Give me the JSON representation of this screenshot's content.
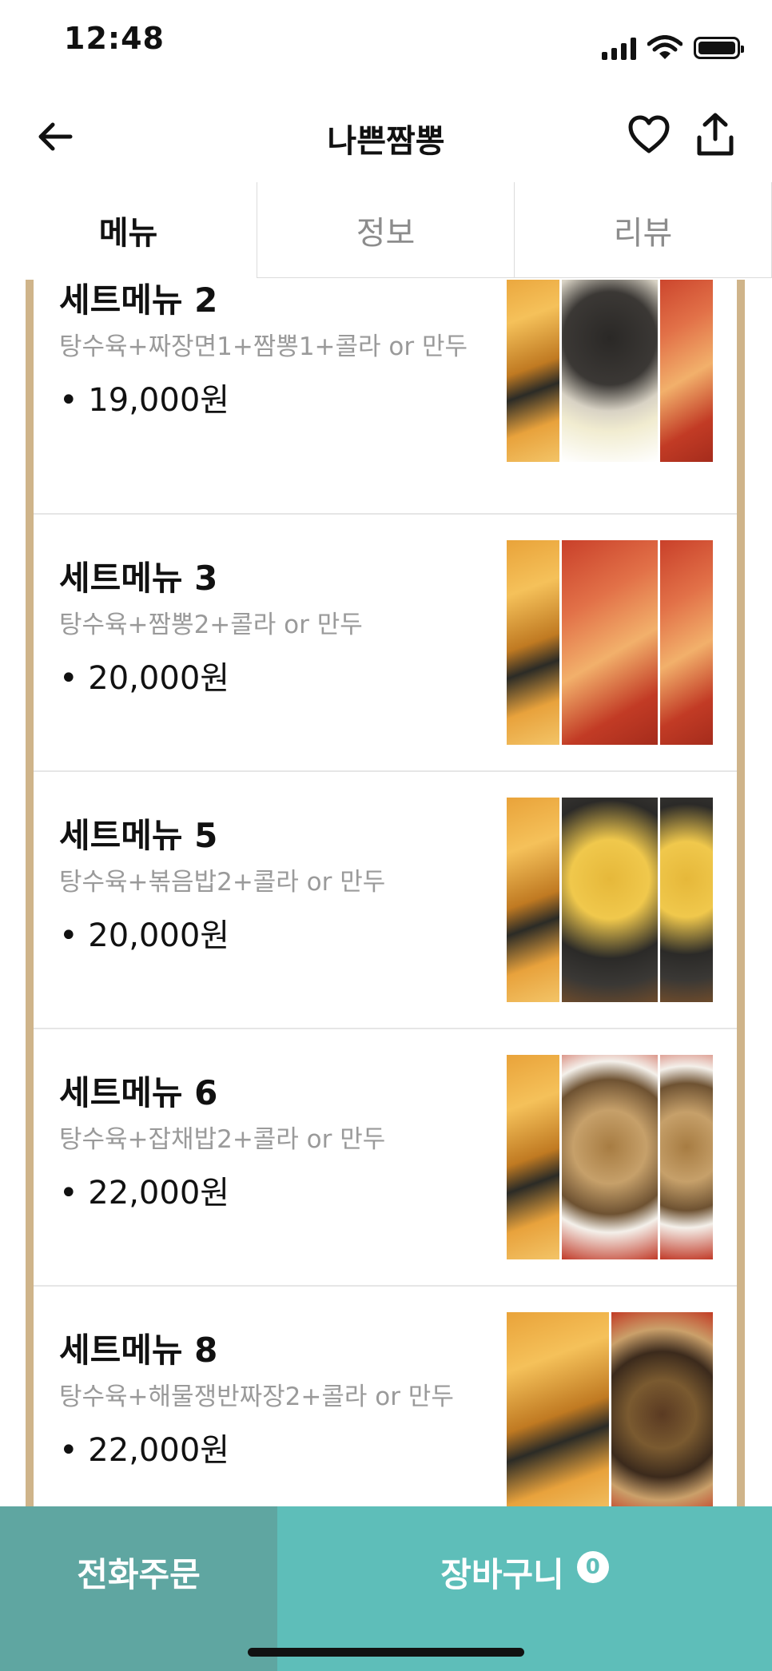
{
  "status_bar": {
    "time": "12:48"
  },
  "header": {
    "title": "나쁜짬뽕"
  },
  "tabs": [
    {
      "label": "메뉴",
      "active": true
    },
    {
      "label": "정보",
      "active": false
    },
    {
      "label": "리뷰",
      "active": false
    }
  ],
  "menu_items": [
    {
      "name": "세트메뉴 2",
      "desc": "탕수육+짜장면1+짬뽕1+콜라 or 만두",
      "price": "• 19,000원"
    },
    {
      "name": "세트메뉴 3",
      "desc": "탕수육+짬뽕2+콜라 or 만두",
      "price": "• 20,000원"
    },
    {
      "name": "세트메뉴 5",
      "desc": "탕수육+볶음밥2+콜라 or 만두",
      "price": "• 20,000원"
    },
    {
      "name": "세트메뉴 6",
      "desc": "탕수육+잡채밥2+콜라 or 만두",
      "price": "• 22,000원"
    },
    {
      "name": "세트메뉴 8",
      "desc": "탕수육+해물쟁반짜장2+콜라 or 만두",
      "price": "• 22,000원"
    }
  ],
  "bottom_bar": {
    "call_label": "전화주문",
    "cart_label": "장바구니",
    "cart_count": "0"
  },
  "colors": {
    "accent_border": "#cfb48a",
    "call_button": "#5fa6a1",
    "cart_button": "#5ebeb9"
  }
}
